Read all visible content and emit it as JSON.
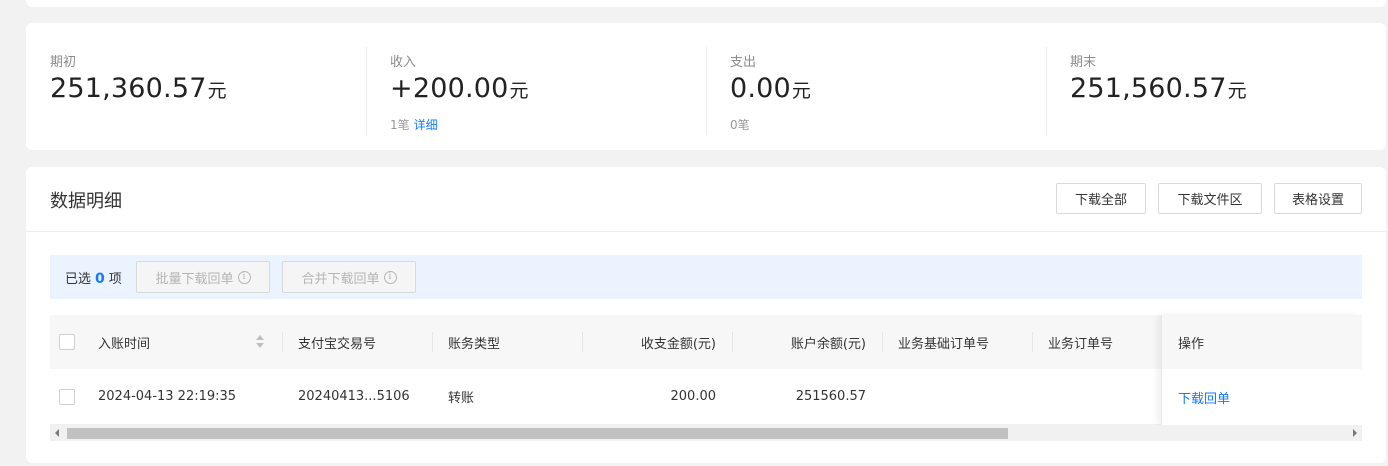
{
  "summary": {
    "opening": {
      "label": "期初",
      "value": "251,360.57",
      "unit": "元"
    },
    "income": {
      "label": "收入",
      "value": "+200.00",
      "unit": "元",
      "sub": "1笔",
      "sub_link": "详细"
    },
    "expense": {
      "label": "支出",
      "value": "0.00",
      "unit": "元",
      "sub": "0笔"
    },
    "closing": {
      "label": "期末",
      "value": "251,560.57",
      "unit": "元"
    }
  },
  "detail": {
    "title": "数据明细",
    "buttons": {
      "download_all": "下载全部",
      "download_area": "下载文件区",
      "table_settings": "表格设置"
    }
  },
  "selection": {
    "prefix": "已选",
    "count": "0",
    "suffix": "项",
    "batch_download": "批量下载回单",
    "merge_download": "合并下载回单",
    "info_glyph": "i"
  },
  "table": {
    "columns": [
      "入账时间",
      "支付宝交易号",
      "账务类型",
      "收支金额(元)",
      "账户余额(元)",
      "业务基础订单号",
      "业务订单号",
      "操作"
    ],
    "rows": [
      {
        "time": "2024-04-13 22:19:35",
        "trade_no": "20240413...5106",
        "type": "转账",
        "amount": "200.00",
        "balance": "251560.57",
        "base_order": "",
        "order": "",
        "action": "下载回单"
      }
    ]
  },
  "icons": {
    "sort": "sort-icon",
    "info": "info-circle-icon",
    "scroll_left": "arrow-left-icon",
    "scroll_right": "arrow-right-icon"
  },
  "colors": {
    "accent": "#1677ff",
    "select_bar_bg": "#ebf3ff",
    "page_bg": "#f2f2f2"
  }
}
